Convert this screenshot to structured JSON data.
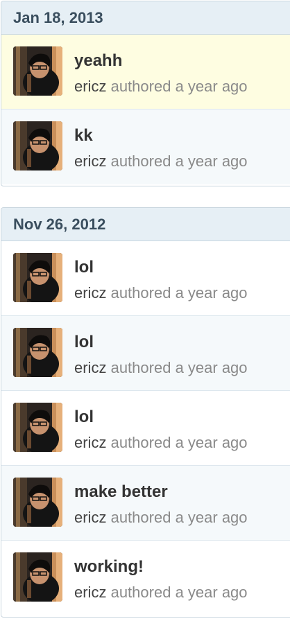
{
  "groups": [
    {
      "date": "Jan 18, 2013",
      "commits": [
        {
          "message": "yeahh",
          "author": "ericz",
          "action": "authored",
          "time": "a year ago",
          "highlighted": true
        },
        {
          "message": "kk",
          "author": "ericz",
          "action": "authored",
          "time": "a year ago",
          "highlighted": false
        }
      ]
    },
    {
      "date": "Nov 26, 2012",
      "commits": [
        {
          "message": "lol",
          "author": "ericz",
          "action": "authored",
          "time": "a year ago",
          "highlighted": false
        },
        {
          "message": "lol",
          "author": "ericz",
          "action": "authored",
          "time": "a year ago",
          "highlighted": false
        },
        {
          "message": "lol",
          "author": "ericz",
          "action": "authored",
          "time": "a year ago",
          "highlighted": false
        },
        {
          "message": "make better",
          "author": "ericz",
          "action": "authored",
          "time": "a year ago",
          "highlighted": false
        },
        {
          "message": "working!",
          "author": "ericz",
          "action": "authored",
          "time": "a year ago",
          "highlighted": false
        }
      ]
    }
  ],
  "colors": {
    "header_bg": "#e6eff5",
    "highlight_bg": "#fefde1",
    "row_alt_bg": "#f5f9fb",
    "border": "#c9d6df",
    "text_dark": "#333333",
    "text_muted": "#8a8a8a"
  }
}
